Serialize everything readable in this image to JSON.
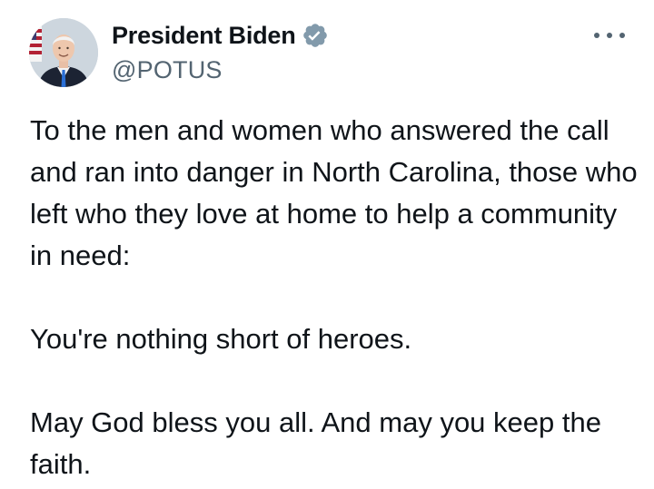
{
  "author": {
    "display_name": "President Biden",
    "handle": "@POTUS",
    "verified_icon": "verified-badge-icon",
    "badge_color": "#829aab"
  },
  "menu": {
    "icon": "more-options-icon"
  },
  "tweet": {
    "paragraph_1": "To the men and women who answered the call and ran into danger in North Carolina, those who left who they love at home to help a community in need:",
    "paragraph_2": "You're nothing short of heroes.",
    "paragraph_3": "May God bless you all. And may you keep the faith."
  },
  "colors": {
    "text_primary": "#0f1419",
    "text_secondary": "#536471",
    "background": "#ffffff"
  }
}
